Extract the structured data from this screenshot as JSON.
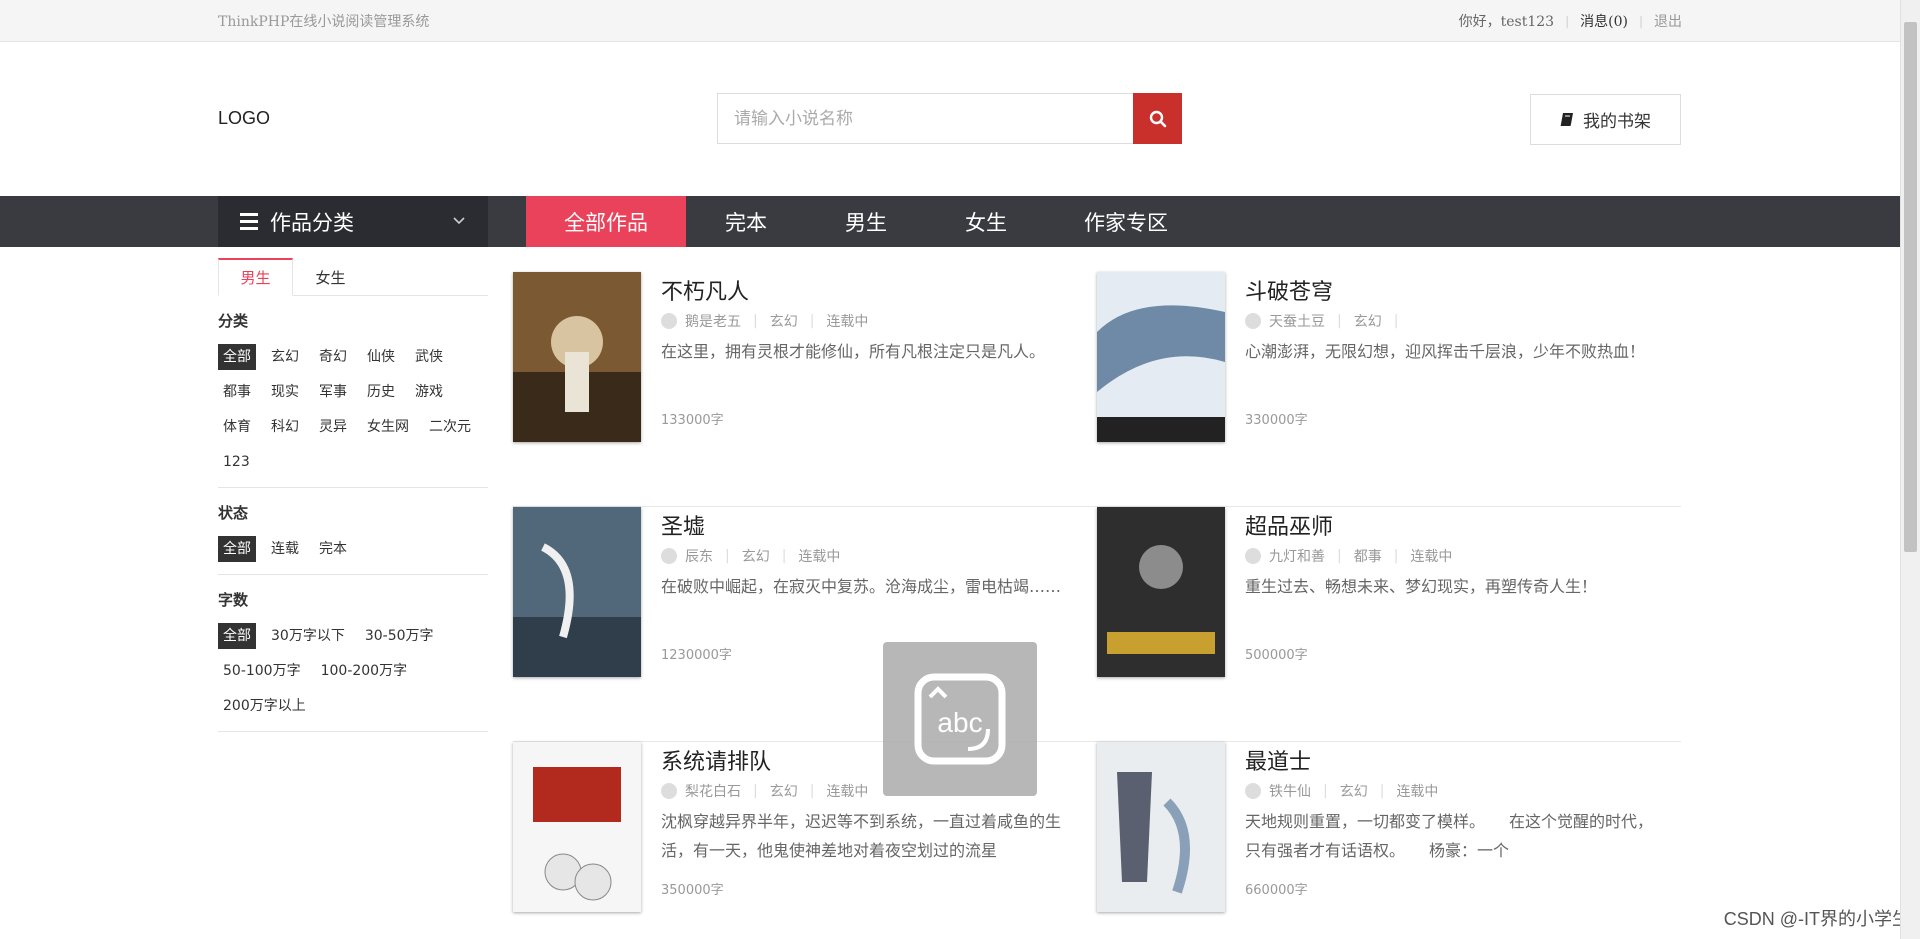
{
  "topbar": {
    "site_name": "ThinkPHP在线小说阅读管理系统",
    "greeting": "你好，test123",
    "messages": "消息(0)",
    "logout": "退出"
  },
  "header": {
    "logo": "LOGO",
    "search_placeholder": "请输入小说名称",
    "shelf_label": "我的书架"
  },
  "nav": {
    "category_label": "作品分类",
    "items": [
      "全部作品",
      "完本",
      "男生",
      "女生",
      "作家专区"
    ],
    "active_index": 0,
    "accent": "#e9425a"
  },
  "sidebar": {
    "tabs": [
      "男生",
      "女生"
    ],
    "active_tab": 0,
    "category_title": "分类",
    "categories": [
      "全部",
      "玄幻",
      "奇幻",
      "仙侠",
      "武侠",
      "都事",
      "现实",
      "军事",
      "历史",
      "游戏",
      "体育",
      "科幻",
      "灵异",
      "女生网",
      "二次元",
      "123"
    ],
    "status_title": "状态",
    "statuses": [
      "全部",
      "连载",
      "完本"
    ],
    "words_title": "字数",
    "word_ranges": [
      "全部",
      "30万字以下",
      "30-50万字",
      "50-100万字",
      "100-200万字",
      "200万字以上"
    ]
  },
  "books": [
    {
      "title": "不朽凡人",
      "author": "鹅是老五",
      "genre": "玄幻",
      "status": "连载中",
      "desc": "在这里，拥有灵根才能修仙，所有凡根注定只是凡人。",
      "words": "133000字",
      "cover_color": "#8a6a3a"
    },
    {
      "title": "斗破苍穹",
      "author": "天蚕土豆",
      "genre": "玄幻",
      "status": "",
      "desc": "心潮澎湃，无限幻想，迎风挥击千层浪，少年不败热血！",
      "words": "330000字",
      "cover_color": "#dfe6ee"
    },
    {
      "title": "圣墟",
      "author": "辰东",
      "genre": "玄幻",
      "status": "连载中",
      "desc": "在破败中崛起，在寂灭中复苏。沧海成尘，雷电枯竭……",
      "words": "1230000字",
      "cover_color": "#5a7080"
    },
    {
      "title": "超品巫师",
      "author": "九灯和善",
      "genre": "都事",
      "status": "连载中",
      "desc": "重生过去、畅想未来、梦幻现实，再塑传奇人生！",
      "words": "500000字",
      "cover_color": "#3a3a3a"
    },
    {
      "title": "系统请排队",
      "author": "梨花白石",
      "genre": "玄幻",
      "status": "连载中",
      "desc": "沈枫穿越异界半年，迟迟等不到系统，一直过着咸鱼的生活，有一天，他鬼使神差地对着夜空划过的流星",
      "words": "350000字",
      "cover_color": "#f4f4f4"
    },
    {
      "title": "最道士",
      "author": "铁牛仙",
      "genre": "玄幻",
      "status": "连载中",
      "desc": "天地规则重置，一切都变了模样。　　在这个觉醒的时代，只有强者才有话语权。　　杨豪：一个",
      "words": "660000字",
      "cover_color": "#e8ecef"
    }
  ],
  "overlay": {
    "label": "abc"
  },
  "watermark": "CSDN @-IT界的小学生"
}
